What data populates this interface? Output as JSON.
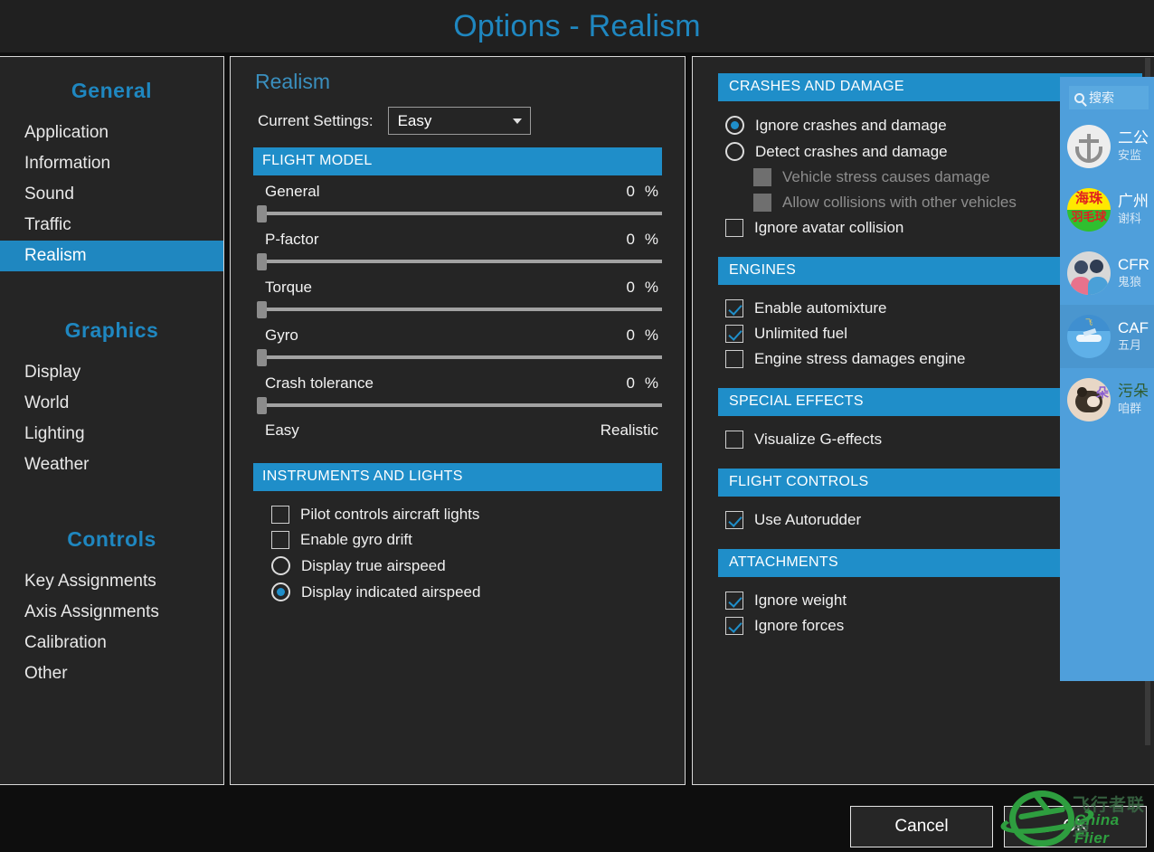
{
  "window": {
    "title": "Options - Realism"
  },
  "sidebar": {
    "groups": [
      {
        "title": "General",
        "items": [
          {
            "label": "Application",
            "active": false
          },
          {
            "label": "Information",
            "active": false
          },
          {
            "label": "Sound",
            "active": false
          },
          {
            "label": "Traffic",
            "active": false
          },
          {
            "label": "Realism",
            "active": true
          }
        ]
      },
      {
        "title": "Graphics",
        "items": [
          {
            "label": "Display",
            "active": false
          },
          {
            "label": "World",
            "active": false
          },
          {
            "label": "Lighting",
            "active": false
          },
          {
            "label": "Weather",
            "active": false
          }
        ]
      },
      {
        "title": "Controls",
        "items": [
          {
            "label": "Key Assignments",
            "active": false
          },
          {
            "label": "Axis Assignments",
            "active": false
          },
          {
            "label": "Calibration",
            "active": false
          },
          {
            "label": "Other",
            "active": false
          }
        ]
      }
    ]
  },
  "center": {
    "pane_title": "Realism",
    "current_settings_label": "Current Settings:",
    "current_settings_value": "Easy",
    "flight_model": {
      "heading": "FLIGHT MODEL",
      "sliders": [
        {
          "label": "General",
          "value": "0",
          "unit": "%",
          "percent": 0
        },
        {
          "label": "P-factor",
          "value": "0",
          "unit": "%",
          "percent": 0
        },
        {
          "label": "Torque",
          "value": "0",
          "unit": "%",
          "percent": 0
        },
        {
          "label": "Gyro",
          "value": "0",
          "unit": "%",
          "percent": 0
        },
        {
          "label": "Crash tolerance",
          "value": "0",
          "unit": "%",
          "percent": 0
        }
      ],
      "scale_min": "Easy",
      "scale_max": "Realistic"
    },
    "instruments": {
      "heading": "INSTRUMENTS AND LIGHTS",
      "options": [
        {
          "label": "Pilot controls aircraft lights",
          "type": "checkbox",
          "checked": false,
          "disabled": false
        },
        {
          "label": "Enable gyro drift",
          "type": "checkbox",
          "checked": false,
          "disabled": false
        },
        {
          "label": "Display true airspeed",
          "type": "radio",
          "checked": false,
          "disabled": false
        },
        {
          "label": "Display indicated airspeed",
          "type": "radio",
          "checked": true,
          "disabled": false
        }
      ]
    }
  },
  "right": {
    "sections": [
      {
        "heading": "CRASHES AND DAMAGE",
        "options": [
          {
            "label": "Ignore crashes and damage",
            "type": "radio",
            "checked": true,
            "disabled": false,
            "indent": false
          },
          {
            "label": "Detect crashes and damage",
            "type": "radio",
            "checked": false,
            "disabled": false,
            "indent": false
          },
          {
            "label": "Vehicle stress causes damage",
            "type": "checkbox",
            "checked": false,
            "disabled": true,
            "indent": true
          },
          {
            "label": "Allow collisions with other vehicles",
            "type": "checkbox",
            "checked": false,
            "disabled": true,
            "indent": true
          },
          {
            "label": "Ignore avatar collision",
            "type": "checkbox",
            "checked": false,
            "disabled": false,
            "indent": false
          }
        ]
      },
      {
        "heading": "ENGINES",
        "options": [
          {
            "label": "Enable automixture",
            "type": "checkbox",
            "checked": true,
            "disabled": false,
            "indent": false
          },
          {
            "label": "Unlimited fuel",
            "type": "checkbox",
            "checked": true,
            "disabled": false,
            "indent": false
          },
          {
            "label": "Engine stress damages engine",
            "type": "checkbox",
            "checked": false,
            "disabled": false,
            "indent": false
          }
        ]
      },
      {
        "heading": "SPECIAL EFFECTS",
        "options": [
          {
            "label": "Visualize G-effects",
            "type": "checkbox",
            "checked": false,
            "disabled": false,
            "indent": false
          }
        ]
      },
      {
        "heading": "FLIGHT CONTROLS",
        "options": [
          {
            "label": "Use Autorudder",
            "type": "checkbox",
            "checked": true,
            "disabled": false,
            "indent": false
          }
        ]
      },
      {
        "heading": "ATTACHMENTS",
        "options": [
          {
            "label": "Ignore weight",
            "type": "checkbox",
            "checked": true,
            "disabled": false,
            "indent": false
          },
          {
            "label": "Ignore forces",
            "type": "checkbox",
            "checked": true,
            "disabled": false,
            "indent": false
          }
        ]
      }
    ]
  },
  "footer": {
    "cancel_label": "Cancel",
    "ok_label": "OK"
  },
  "qq_overlay": {
    "search_placeholder": "搜索",
    "contacts": [
      {
        "name": "二公",
        "sub": "安监",
        "avatar": "anchor-avatar",
        "selected": false,
        "name_style": "normal"
      },
      {
        "name": "广州",
        "sub": "谢科",
        "avatar": "haizhu-avatar",
        "selected": false,
        "name_style": "normal"
      },
      {
        "name": "CFR",
        "sub": "鬼狼",
        "avatar": "couple-avatar",
        "selected": false,
        "name_style": "normal"
      },
      {
        "name": "CAF",
        "sub": "五月",
        "avatar": "cafr-avatar",
        "selected": true,
        "name_style": "normal"
      },
      {
        "name": "污朵",
        "sub": "咱群",
        "avatar": "dog-avatar",
        "selected": false,
        "name_style": "alt"
      }
    ]
  },
  "watermark": {
    "cn_text": "飞行者联盟",
    "en_text": "China Flier"
  },
  "colors": {
    "accent_blue": "#1f8ec9",
    "title_blue": "#1f87c0",
    "panel_bg": "#252525",
    "window_bg": "#0e0e0e",
    "overlay_blue": "#4f9fdb",
    "watermark_green": "#2e9e3f"
  }
}
